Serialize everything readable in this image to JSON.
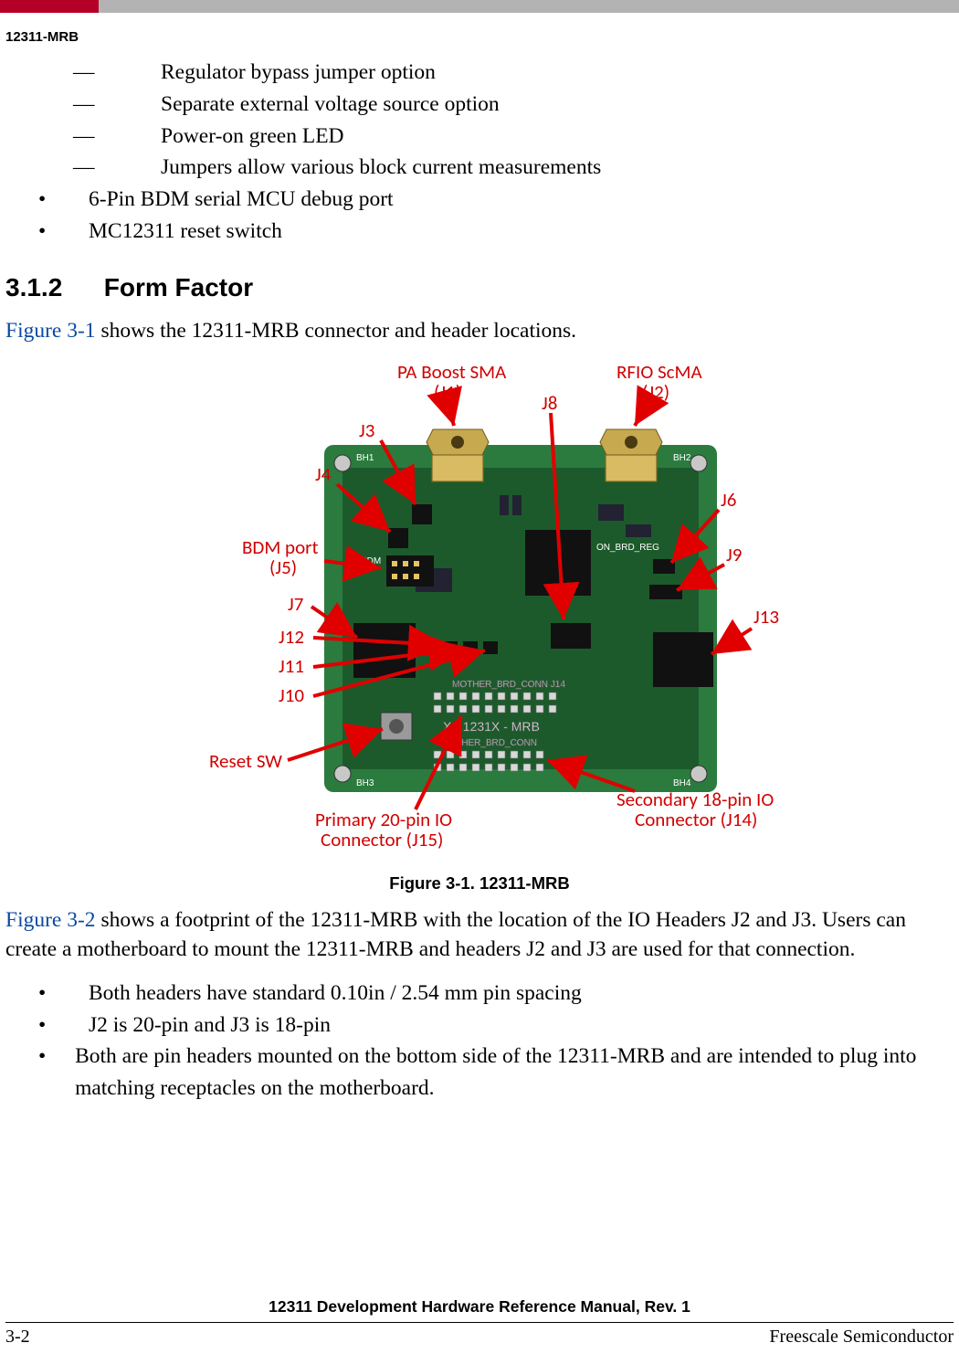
{
  "doc_header": "12311-MRB",
  "dash_items": [
    "Regulator bypass jumper option",
    "Separate external voltage source option",
    "Power-on green LED",
    "Jumpers allow various block current measurements"
  ],
  "bullet_items_top": [
    "6-Pin BDM serial MCU debug port",
    "MC12311 reset switch"
  ],
  "section": {
    "num": "3.1.2",
    "title": "Form Factor"
  },
  "p1_pre": "",
  "p1_ref": "Figure 3-1",
  "p1_post": " shows the 12311-MRB connector and header locations.",
  "figure": {
    "caption": "Figure 3-1. 12311-MRB",
    "labels": {
      "pa_boost_l1": "PA Boost SMA",
      "pa_boost_l2": "(J1)",
      "rfio_l1": "RFIO ScMA",
      "rfio_l2": "(J2)",
      "j8": "J8",
      "j3": "J3",
      "j4": "J4",
      "bdm_l1": "BDM port",
      "bdm_l2": "(J5)",
      "j6": "J6",
      "j9": "J9",
      "j7": "J7",
      "j12": "J12",
      "j11": "J11",
      "j10": "J10",
      "j13": "J13",
      "reset": "Reset SW",
      "primary_l1": "Primary 20-pin IO",
      "primary_l2": "Connector  (J15)",
      "secondary_l1": "Secondary 18-pin IO",
      "secondary_l2": "Connector  (J14)"
    },
    "board_silk": {
      "name": "X - 1231X - MRB",
      "row1": "MOTHER_BRD_CONN J14",
      "row2": "MOTHER_BRD_CONN",
      "bh1": "BH1",
      "bh2": "BH2",
      "bh3": "BH3",
      "bh4": "BH4",
      "bdm": "BDM",
      "reg": "ON_BRD_REG"
    }
  },
  "p2_ref": "Figure 3-2",
  "p2_post": " shows a footprint of the 12311-MRB with the location of the IO Headers J2 and J3. Users can create a motherboard to mount the 12311-MRB and headers J2 and J3 are used for that connection.",
  "bullet_items_bottom": [
    "Both headers have standard 0.10in / 2.54 mm pin spacing",
    "J2 is 20-pin and J3 is 18-pin",
    "Both are pin headers mounted on the bottom side of the 12311-MRB and are intended to plug into matching receptacles on the motherboard."
  ],
  "footer": {
    "title": "12311 Development Hardware Reference Manual, Rev. 1",
    "left": "3-2",
    "right": "Freescale Semiconductor"
  }
}
